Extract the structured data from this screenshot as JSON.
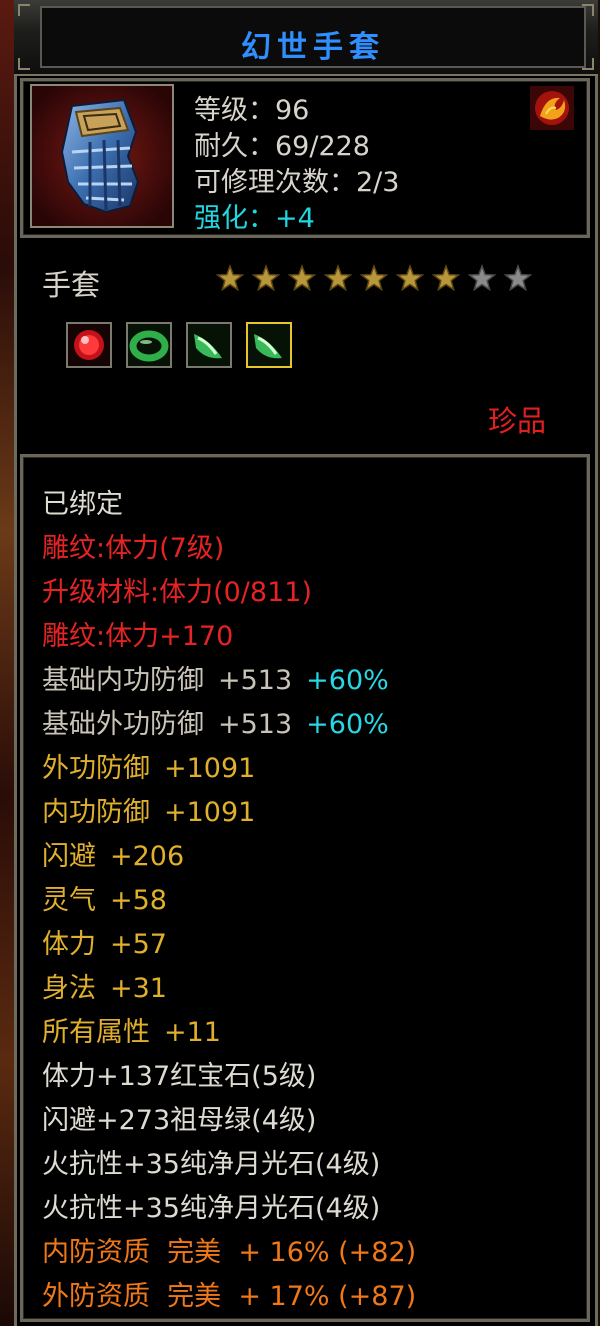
{
  "title": "幻世手套",
  "item": {
    "icon": "blue-armored-glove",
    "level_label": "等级：",
    "level": "96",
    "durability_label": "耐久：",
    "durability": "69/228",
    "repair_label": "可修理次数：",
    "repair": "2/3",
    "enhance_label": "强化：",
    "enhance": "+4",
    "emblem_icon": "red-phoenix-emblem-icon",
    "type": "手套",
    "stars_total": 9,
    "stars_filled": 7,
    "gems": [
      "ruby-icon",
      "jade-bracelet-icon",
      "moonstone-icon",
      "moonstone-icon"
    ],
    "rarity": "珍品"
  },
  "attributes": {
    "bound": "已绑定",
    "engrave_level": "雕纹:体力(7级)",
    "upgrade_material": "升级材料:体力(0/811)",
    "engrave_bonus": "雕纹:体力+170",
    "base_inner_def_name": "基础内功防御",
    "base_inner_def_val": "+513",
    "base_inner_def_pct": "+60%",
    "base_outer_def_name": "基础外功防御",
    "base_outer_def_val": "+513",
    "base_outer_def_pct": "+60%",
    "outer_def_name": "外功防御",
    "outer_def_val": "+1091",
    "inner_def_name": "内功防御",
    "inner_def_val": "+1091",
    "dodge_name": "闪避",
    "dodge_val": "+206",
    "spirit_name": "灵气",
    "spirit_val": "+58",
    "stamina_name": "体力",
    "stamina_val": "+57",
    "agility_name": "身法",
    "agility_val": "+31",
    "allattr_name": "所有属性",
    "allattr_val": "+11",
    "gem1": "体力+137红宝石(5级)",
    "gem2": "闪避+273祖母绿(4级)",
    "gem3": "火抗性+35纯净月光石(4级)",
    "gem4": "火抗性+35纯净月光石(4级)",
    "inner_quality": "内防资质  完美  + 16% (+82)",
    "outer_quality": "外防资质  完美  + 17% (+87)"
  },
  "colors": {
    "title": "#2f8fff",
    "red": "#e52323",
    "gold": "#e0b02c",
    "cyan": "#27d7e3",
    "orange": "#f07818"
  }
}
